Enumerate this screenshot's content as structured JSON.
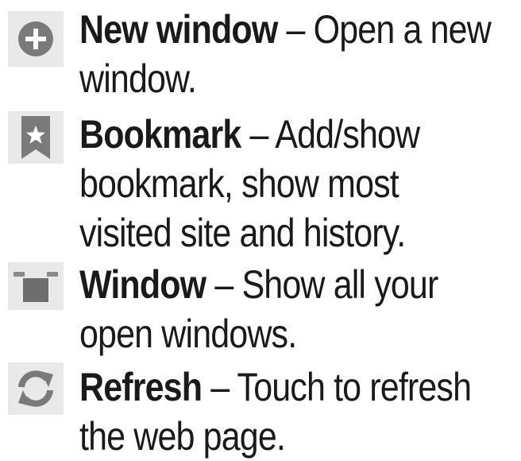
{
  "items": [
    {
      "icon": "plus-circle-icon",
      "term": "New window",
      "separator": " – ",
      "line1_rest": "Open a new",
      "line2": "window."
    },
    {
      "icon": "bookmark-star-icon",
      "term": "Bookmark",
      "separator": " – ",
      "line1_rest": "Add/show",
      "line2": "bookmark, show most",
      "line3": "visited site and history."
    },
    {
      "icon": "windows-icon",
      "term": "Window",
      "separator": " – ",
      "line1_rest": "Show all your",
      "line2": "open windows."
    },
    {
      "icon": "refresh-icon",
      "term": "Refresh",
      "separator": " – ",
      "line1_rest": "Touch to refresh",
      "line2": "the web page."
    }
  ],
  "colors": {
    "text": "#1a1a1a",
    "icon_bg": "#e9e9e9",
    "icon_fg": "#7a7a7a"
  }
}
